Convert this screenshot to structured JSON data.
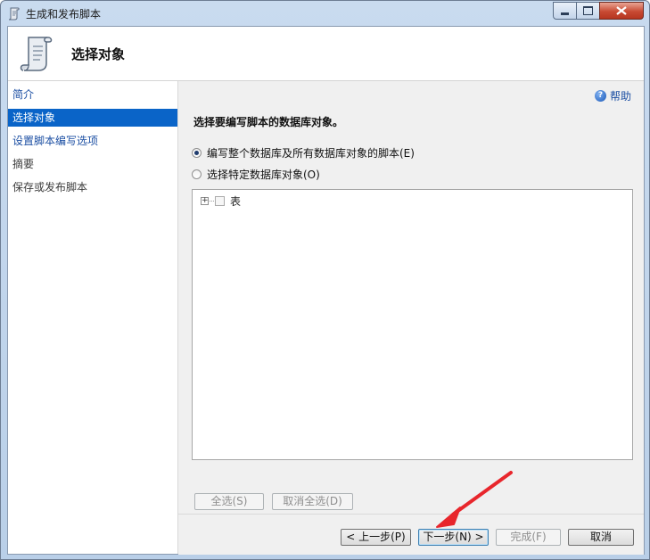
{
  "window": {
    "title": "生成和发布脚本",
    "controls": {
      "minimize": "minimize",
      "maximize": "maximize",
      "close": "close"
    }
  },
  "header": {
    "title": "选择对象",
    "icon": "script-scroll-icon"
  },
  "sidebar": {
    "items": [
      {
        "label": "简介",
        "state": "link"
      },
      {
        "label": "选择对象",
        "state": "selected"
      },
      {
        "label": "设置脚本编写选项",
        "state": "link"
      },
      {
        "label": "摘要",
        "state": "plain"
      },
      {
        "label": "保存或发布脚本",
        "state": "plain"
      }
    ]
  },
  "main": {
    "help_label": "帮助",
    "section_label": "选择要编写脚本的数据库对象。",
    "options": [
      {
        "label": "编写整个数据库及所有数据库对象的脚本(E)",
        "checked": true
      },
      {
        "label": "选择特定数据库对象(O)",
        "checked": false
      }
    ],
    "tree": {
      "items": [
        {
          "label": "表",
          "expanded": false,
          "checked": false
        }
      ]
    },
    "select_all_label": "全选(S)",
    "deselect_all_label": "取消全选(D)"
  },
  "footer": {
    "prev_label": "< 上一步(P)",
    "next_label": "下一步(N) >",
    "finish_label": "完成(F)",
    "cancel_label": "取消"
  },
  "colors": {
    "selection": "#0a64c8",
    "link": "#1c4fa3",
    "annotation_arrow": "#e8262c"
  }
}
